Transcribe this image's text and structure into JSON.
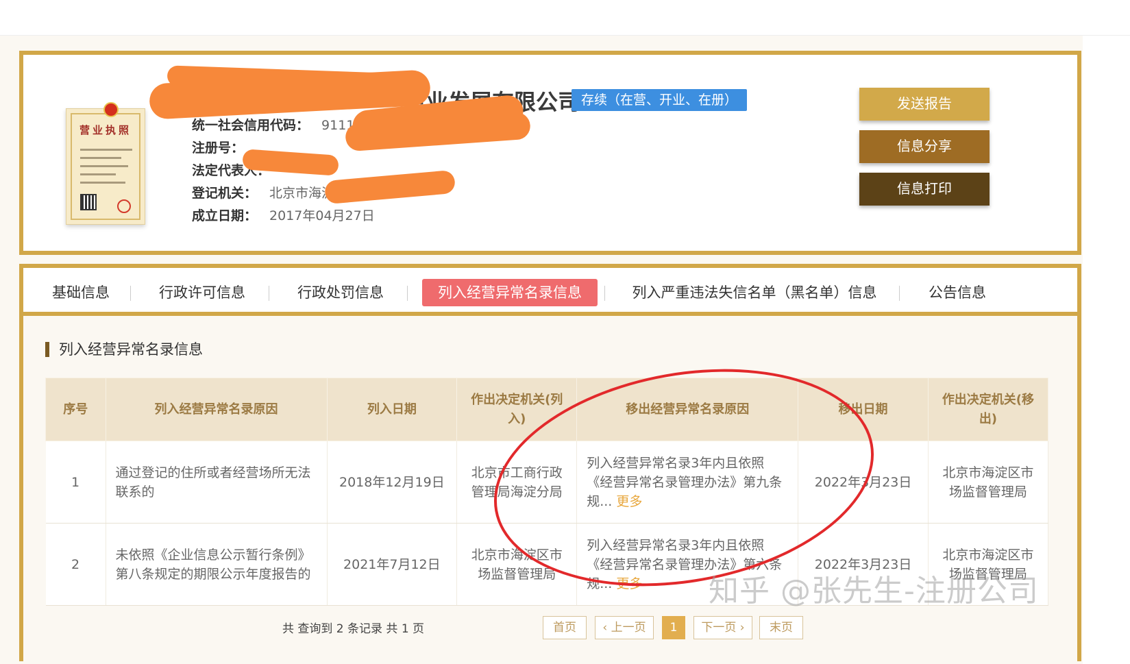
{
  "company": {
    "name_visible": "企业发展有限公司",
    "status": "存续（在营、开业、在册）",
    "info": [
      {
        "label": "统一社会信用代码：",
        "value": "9111"
      },
      {
        "label": "注册号：",
        "value": ""
      },
      {
        "label": "法定代表人：",
        "value": ""
      },
      {
        "label": "登记机关：",
        "value": "北京市海淀区"
      },
      {
        "label": "成立日期：",
        "value": "2017年04月27日"
      }
    ],
    "license_title": "营业执照"
  },
  "actions": {
    "send_report": "发送报告",
    "share_info": "信息分享",
    "print_info": "信息打印"
  },
  "tabs": [
    {
      "label": "基础信息",
      "active": false
    },
    {
      "label": "行政许可信息",
      "active": false
    },
    {
      "label": "行政处罚信息",
      "active": false
    },
    {
      "label": "列入经营异常名录信息",
      "active": true
    },
    {
      "label": "列入严重违法失信名单（黑名单）信息",
      "active": false
    },
    {
      "label": "公告信息",
      "active": false
    }
  ],
  "section": {
    "title": "列入经营异常名录信息"
  },
  "table": {
    "headers": [
      "序号",
      "列入经营异常名录原因",
      "列入日期",
      "作出决定机关(列入)",
      "移出经营异常名录原因",
      "移出日期",
      "作出决定机关(移出)"
    ],
    "rows": [
      {
        "no": "1",
        "reason": "通过登记的住所或者经营场所无法联系的",
        "date_in": "2018年12月19日",
        "authority_in": "北京市工商行政管理局海淀分局",
        "reason_out": "列入经营异常名录3年内且依照《经营异常名录管理办法》第九条规...",
        "more": "更多",
        "date_out": "2022年3月23日",
        "authority_out": "北京市海淀区市场监督管理局"
      },
      {
        "no": "2",
        "reason": "未依照《企业信息公示暂行条例》第八条规定的期限公示年度报告的",
        "date_in": "2021年7月12日",
        "authority_in": "北京市海淀区市场监督管理局",
        "reason_out": "列入经营异常名录3年内且依照《经营异常名录管理办法》第六条规...",
        "more": "更多",
        "date_out": "2022年3月23日",
        "authority_out": "北京市海淀区市场监督管理局"
      }
    ]
  },
  "pagination": {
    "summary": "共 查询到 2 条记录 共 1 页",
    "first": "首页",
    "prev": "‹ 上一页",
    "current": "1",
    "next": "下一页 ›",
    "last": "末页"
  },
  "watermark": "知乎 @张先生-注册公司",
  "colors": {
    "gold_border": "#d1a748",
    "status_blue": "#3d8fe0",
    "active_tab": "#ef6b6d",
    "annotation_red": "#e2292b"
  }
}
